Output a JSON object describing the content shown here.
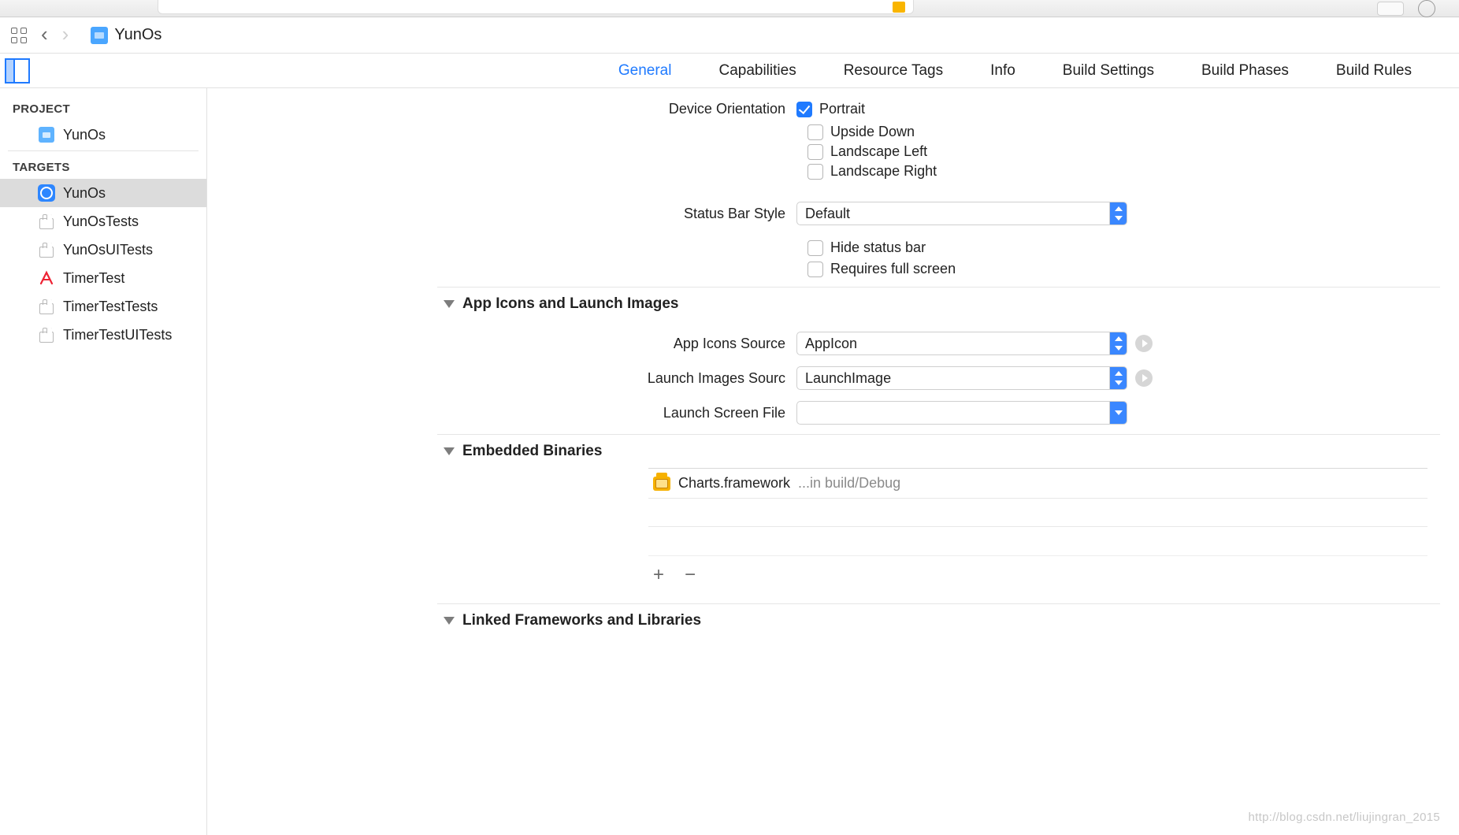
{
  "breadcrumb": {
    "project_name": "YunOs"
  },
  "tabs": {
    "general": "General",
    "capabilities": "Capabilities",
    "resource_tags": "Resource Tags",
    "info": "Info",
    "build_settings": "Build Settings",
    "build_phases": "Build Phases",
    "build_rules": "Build Rules"
  },
  "sidebar": {
    "project_heading": "PROJECT",
    "project_item": "YunOs",
    "targets_heading": "TARGETS",
    "targets": [
      {
        "name": "YunOs",
        "icon": "app",
        "selected": true
      },
      {
        "name": "YunOsTests",
        "icon": "test",
        "selected": false
      },
      {
        "name": "YunOsUITests",
        "icon": "test",
        "selected": false
      },
      {
        "name": "TimerTest",
        "icon": "a",
        "selected": false
      },
      {
        "name": "TimerTestTests",
        "icon": "test",
        "selected": false
      },
      {
        "name": "TimerTestUITests",
        "icon": "test",
        "selected": false
      }
    ]
  },
  "general": {
    "device_orientation_label": "Device Orientation",
    "orientation": {
      "portrait": {
        "label": "Portrait",
        "checked": true
      },
      "upside_down": {
        "label": "Upside Down",
        "checked": false
      },
      "landscape_left": {
        "label": "Landscape Left",
        "checked": false
      },
      "landscape_right": {
        "label": "Landscape Right",
        "checked": false
      }
    },
    "status_bar_style_label": "Status Bar Style",
    "status_bar_style_value": "Default",
    "hide_status_bar": {
      "label": "Hide status bar",
      "checked": false
    },
    "requires_full_screen": {
      "label": "Requires full screen",
      "checked": false
    },
    "section_app_icons": "App Icons and Launch Images",
    "app_icons_source_label": "App Icons Source",
    "app_icons_source_value": "AppIcon",
    "launch_images_source_label": "Launch Images Sourc",
    "launch_images_source_value": "LaunchImage",
    "launch_screen_file_label": "Launch Screen File",
    "launch_screen_file_value": "",
    "section_embedded": "Embedded Binaries",
    "embedded": [
      {
        "name": "Charts.framework",
        "path": "...in build/Debug"
      }
    ],
    "section_linked": "Linked Frameworks and Libraries"
  },
  "watermark": "http://blog.csdn.net/liujingran_2015"
}
